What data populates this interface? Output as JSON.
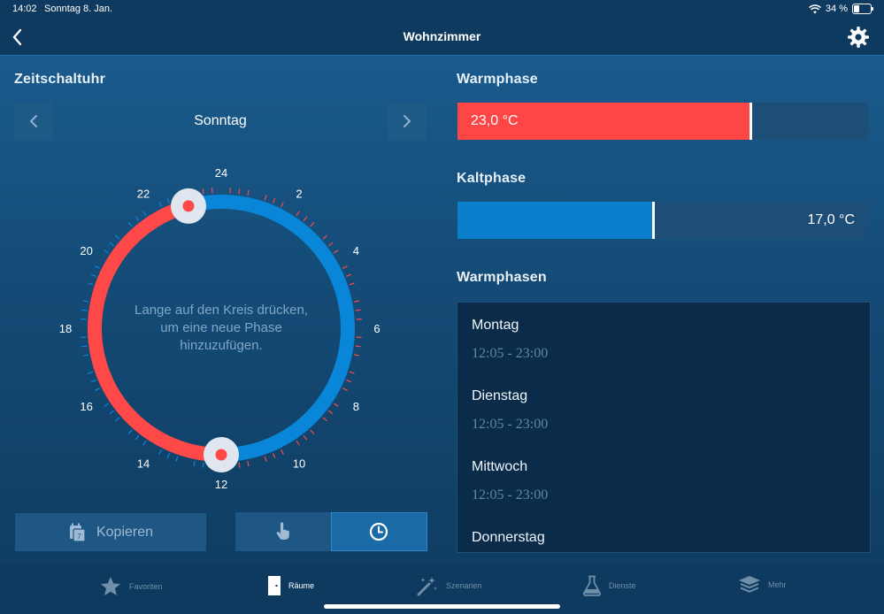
{
  "status": {
    "time": "14:02",
    "date": "Sonntag 8. Jan.",
    "battery": "34 %",
    "battery_level": 0.34
  },
  "nav": {
    "title": "Wohnzimmer"
  },
  "timer": {
    "title": "Zeitschaltuhr",
    "day": "Sonntag",
    "hint": "Lange auf den Kreis drücken, um eine neue Phase hinzuzufügen.",
    "hour_labels": [
      "24",
      "2",
      "4",
      "6",
      "8",
      "10",
      "12",
      "14",
      "16",
      "18",
      "20",
      "22"
    ],
    "warm_start_hour": 23.0,
    "warm_end_hour": 12.0,
    "colors": {
      "warm": "#ff4848",
      "cold": "#0a86d8"
    },
    "copy_label": "Kopieren"
  },
  "warm": {
    "title": "Warmphase",
    "value": "23,0 °C",
    "level": 0.715,
    "color": "#ff4646"
  },
  "cold": {
    "title": "Kaltphase",
    "value": "17,0 °C",
    "level": 0.478,
    "color": "#0a80cc"
  },
  "phases": {
    "title": "Warmphasen",
    "days": [
      {
        "name": "Montag",
        "times": "12:05 - 23:00"
      },
      {
        "name": "Dienstag",
        "times": "12:05 - 23:00"
      },
      {
        "name": "Mittwoch",
        "times": "12:05 - 23:00"
      },
      {
        "name": "Donnerstag",
        "times": ""
      }
    ]
  },
  "tabs": {
    "favoriten": "Favoriten",
    "raeume": "Räume",
    "szenarien": "Szenarien",
    "dienste": "Dienste",
    "mehr": "Mehr"
  }
}
